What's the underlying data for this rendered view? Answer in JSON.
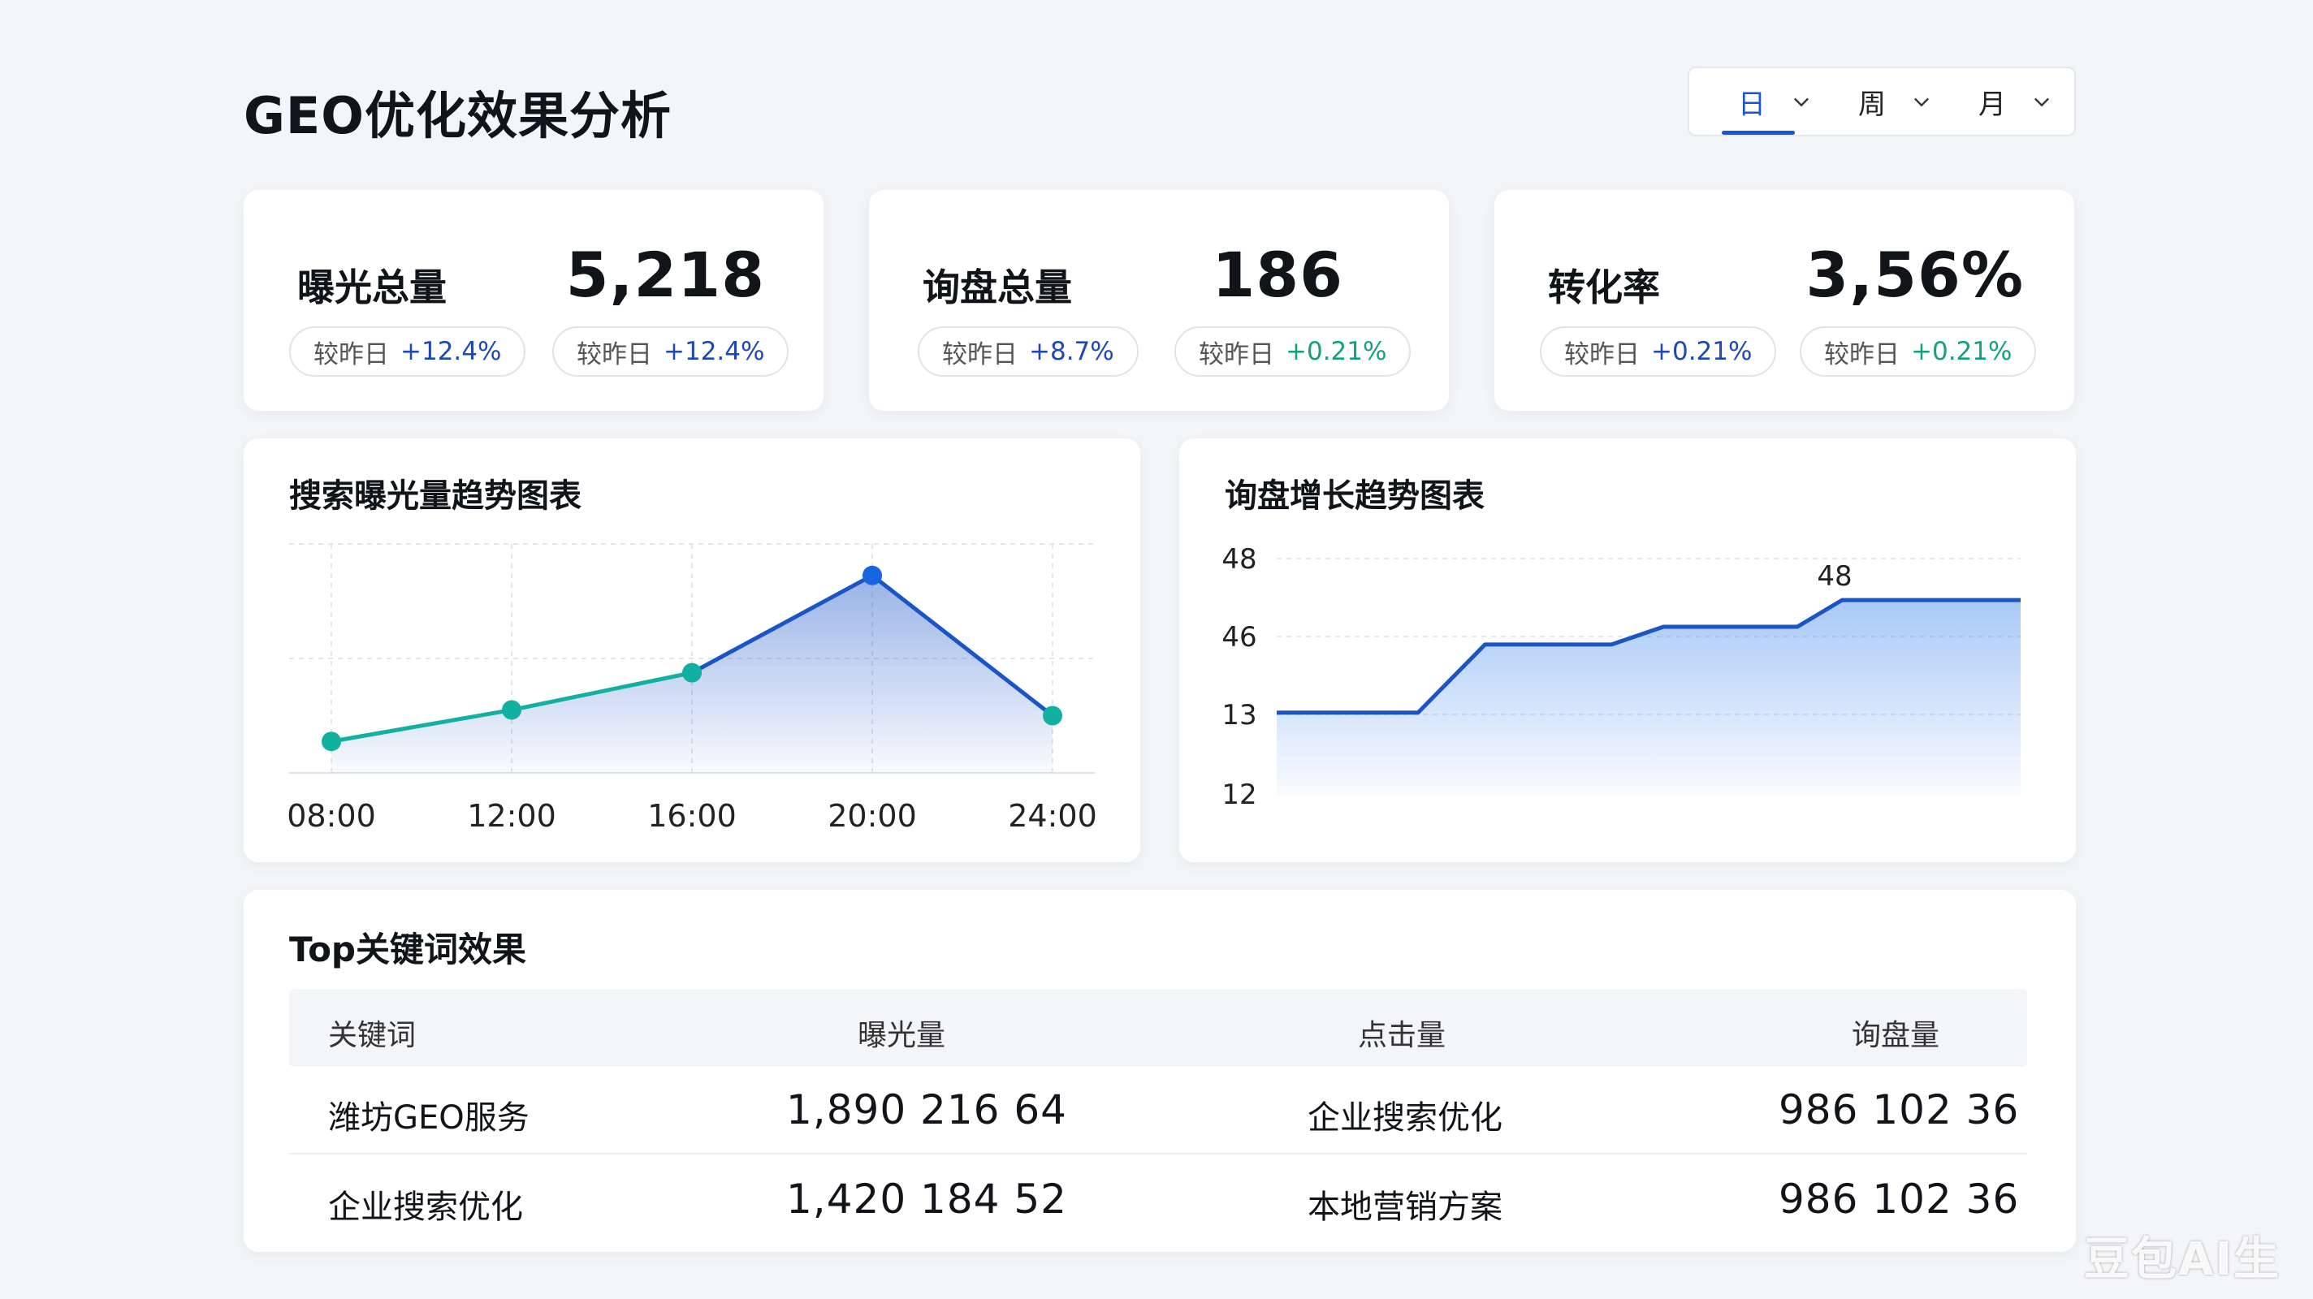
{
  "page": {
    "title": "GEO优化效果分析"
  },
  "range_switch": {
    "items": [
      "日",
      "周",
      "月"
    ],
    "active": "日"
  },
  "kpis": [
    {
      "label": "曝光总量",
      "value": "5,218",
      "pills": [
        {
          "compare": "较昨日",
          "change": "+12.4%",
          "tone": "blue"
        },
        {
          "compare": "较昨日",
          "change": "+12.4%",
          "tone": "blue"
        }
      ]
    },
    {
      "label": "询盘总量",
      "value": "186",
      "pills": [
        {
          "compare": "较昨日",
          "change": "+8.7%",
          "tone": "blue"
        },
        {
          "compare": "较昨日",
          "change": "+0.21%",
          "tone": "green"
        }
      ]
    },
    {
      "label": "转化率",
      "value": "3,56%",
      "pills": [
        {
          "compare": "较昨日",
          "change": "+0.21%",
          "tone": "blue"
        },
        {
          "compare": "较昨日",
          "change": "+0.21%",
          "tone": "green"
        }
      ]
    }
  ],
  "colors": {
    "accent": "#1756d6",
    "teal": "#12b0a0",
    "line_blue": "#1a55c8",
    "positive_blue": "#1c47b8",
    "positive_green": "#12a082"
  },
  "chart_data": [
    {
      "type": "line",
      "title": "搜索曝光量趋势图表",
      "categories": [
        "08:00",
        "12:00",
        "16:00",
        "20:00",
        "24:00"
      ],
      "values": [
        1.1,
        2.2,
        3.5,
        6.9,
        2.0
      ],
      "ylim": [
        0,
        8
      ],
      "grid": true,
      "area_fill": true
    },
    {
      "type": "area",
      "title": "询盘增长趋势图表",
      "ytick_labels": [
        "48",
        "46",
        "13",
        "12"
      ],
      "x": [
        0,
        0.19,
        0.28,
        0.45,
        0.52,
        0.7,
        0.76,
        1.0
      ],
      "values": [
        2.8,
        2.8,
        5.1,
        5.1,
        5.7,
        5.7,
        6.6,
        6.6
      ],
      "ylim": [
        0,
        8
      ],
      "grid": true,
      "annotations": [
        {
          "text": "48",
          "x": 0.75
        }
      ]
    }
  ],
  "table": {
    "title": "Top关键词效果",
    "headers": [
      "关键词",
      "曝光量",
      "点击量",
      "询盘量"
    ],
    "rows": [
      [
        "潍坊GEO服务",
        "1,890  216  64",
        "企业搜索优化",
        "986  102  36"
      ],
      [
        "企业搜索优化",
        "1,420  184  52",
        "本地营销方案",
        "986  102  36"
      ]
    ]
  },
  "watermark": "豆包AI生成"
}
